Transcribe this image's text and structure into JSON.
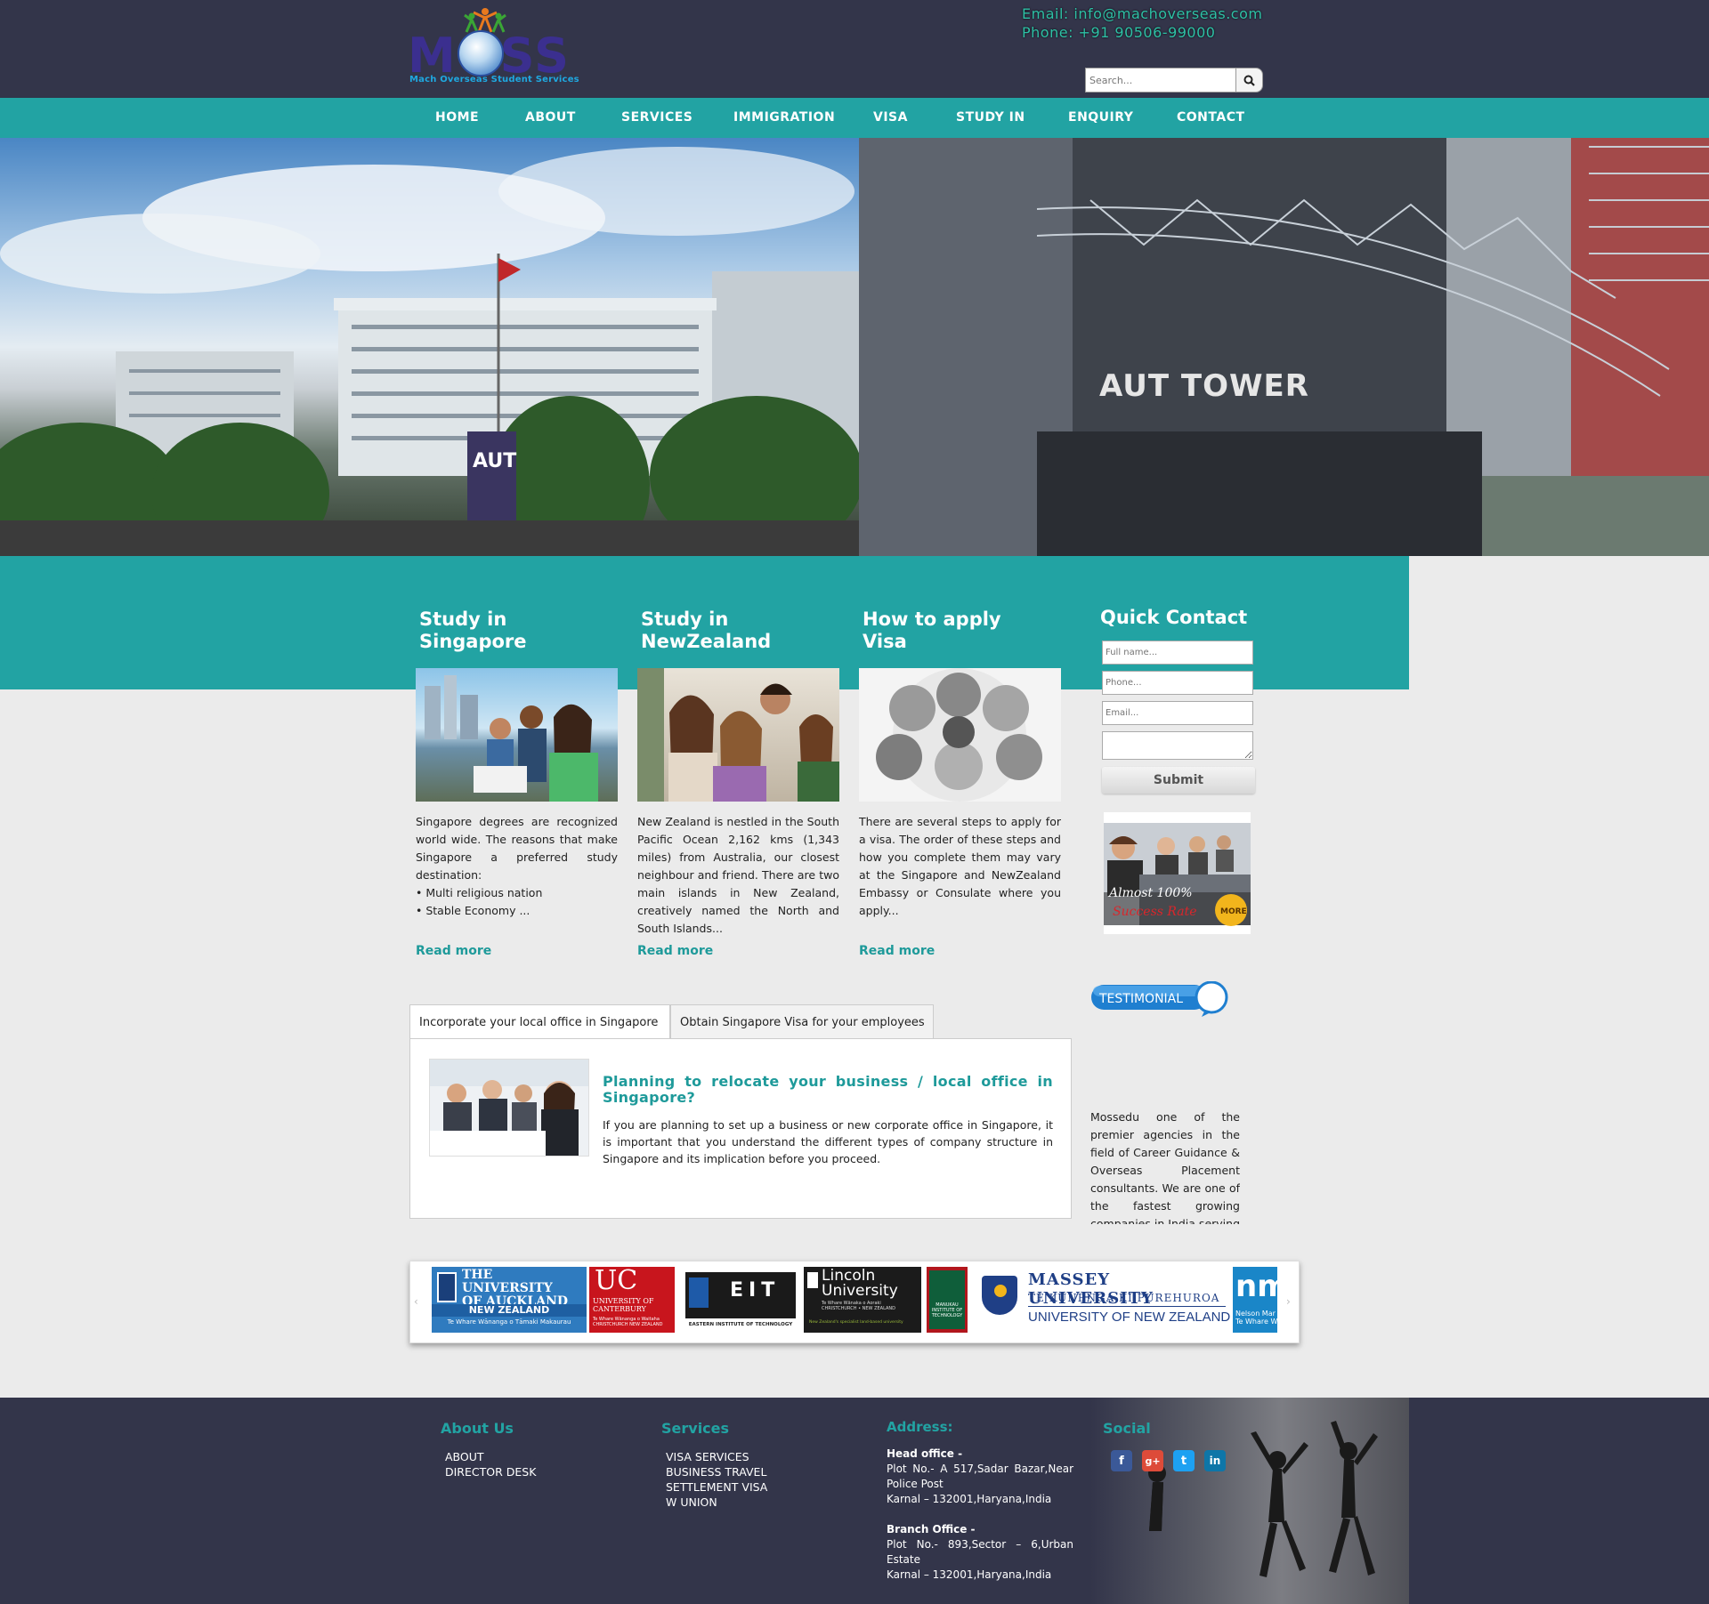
{
  "header": {
    "logo_text": "MOSS",
    "logo_tagline": "Mach Overseas Student Services",
    "email": "Email: info@machoverseas.com",
    "phone": "Phone: +91 90506-99000",
    "search_placeholder": "Search..."
  },
  "nav": [
    "HOME",
    "ABOUT",
    "SERVICES",
    "IMMIGRATION",
    "VISA",
    "STUDY IN",
    "ENQUIRY",
    "CONTACT"
  ],
  "hero": {
    "sign_left": "AUT",
    "sign_right": "AUT TOWER"
  },
  "columns": [
    {
      "title_line1": "Study in",
      "title_line2": "Singapore",
      "text": "Singapore degrees are recognized world wide. The reasons that make Singapore a preferred study destination:",
      "bullets": [
        "• Multi religious nation",
        "• Stable Economy ..."
      ],
      "read_more": "Read more"
    },
    {
      "title_line1": "Study in",
      "title_line2": "NewZealand",
      "text": "New Zealand is nestled in the South Pacific Ocean 2,162 kms (1,343 miles) from Australia, our closest neighbour and friend. There are two main islands in New Zealand, creatively named the North and South Islands...",
      "read_more": "Read more"
    },
    {
      "title_line1": "How to apply",
      "title_line2": "Visa",
      "text": "There are several steps to apply for a visa. The order of these steps and how you complete them may vary at the Singapore and NewZealand Embassy or Consulate where you apply...",
      "read_more": "Read more"
    }
  ],
  "quick_contact": {
    "title": "Quick Contact",
    "name_placeholder": "Full name...",
    "phone_placeholder": "Phone...",
    "email_placeholder": "Email...",
    "submit": "Submit",
    "promo_line1": "Almost 100%",
    "promo_line2": "Success Rate",
    "promo_badge": "MORE"
  },
  "testimonial": {
    "badge": "TESTIMONIAL",
    "text": "Mossedu one of the premier agencies in the field of Career Guidance & Overseas Placement consultants. We are one of the fastest growing companies in India serving people regarding their"
  },
  "tabs": {
    "items": [
      "Incorporate your local office in Singapore",
      "Obtain Singapore Visa for your employees"
    ],
    "panel_title": "Planning to relocate your business / local office in Singapore?",
    "panel_text": "If you are planning to set up a business or new corporate office in Singapore, it is important that you understand the different types of company structure in Singapore and its implication before you proceed."
  },
  "universities": {
    "auckland": [
      "THE UNIVERSITY",
      "OF AUCKLAND",
      "NEW ZEALAND",
      "Te Whare Wānanga o Tāmaki Makaurau"
    ],
    "canterbury": [
      "UC",
      "UNIVERSITY OF",
      "CANTERBURY",
      "Te Whare Wānanga o Waitaha",
      "CHRISTCHURCH NEW ZEALAND"
    ],
    "eit": [
      "EIT",
      "EASTERN INSTITUTE OF TECHNOLOGY"
    ],
    "lincoln": [
      "Lincoln",
      "University",
      "Te Whare Wānaka o Aoraki",
      "CHRISTCHURCH • NEW ZEALAND",
      "New Zealand's specialist land-based university"
    ],
    "manukau": [
      "MANUKAU",
      "INSTITUTE OF",
      "TECHNOLOGY"
    ],
    "massey": [
      "MASSEY UNIVERSITY",
      "TE KUNENGA KI PUREHUROA",
      "UNIVERSITY OF NEW ZEALAND"
    ],
    "nelson": [
      "nm",
      "Nelson Mar",
      "Te Whare W"
    ]
  },
  "footer": {
    "about_title": "About Us",
    "about_links": [
      "ABOUT",
      "DIRECTOR DESK"
    ],
    "services_title": "Services",
    "services_links": [
      "VISA SERVICES",
      "BUSINESS TRAVEL",
      "SETTLEMENT VISA",
      "W UNION"
    ],
    "address_title": "Address:",
    "head_office_label": "Head office -",
    "head_office": [
      "Plot No.- A 517,Sadar Bazar,Near Police Post",
      "Karnal – 132001,Haryana,India"
    ],
    "branch_office_label": "Branch Office -",
    "branch_office": [
      "Plot No.- 893,Sector – 6,Urban Estate",
      "Karnal – 132001,Haryana,India"
    ],
    "social_title": "Social",
    "social_glyphs": [
      "f",
      "g+",
      "t",
      "in"
    ],
    "social_colors": [
      "#3b5998",
      "#dd4b39",
      "#1da1f2",
      "#0e76a8"
    ]
  }
}
